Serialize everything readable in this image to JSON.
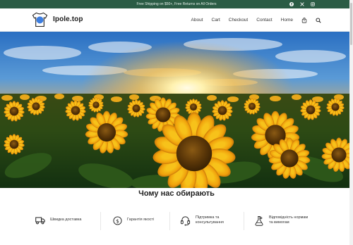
{
  "topbar": {
    "promo": "Free Shipping on $50+, Free Returns on All Orders",
    "socials": [
      "facebook-icon",
      "x-icon",
      "instagram-icon"
    ]
  },
  "header": {
    "brand": "Ipole.top",
    "nav": [
      "About",
      "Cart",
      "Checkout",
      "Contact",
      "Home"
    ],
    "icons": [
      "bag-icon",
      "search-icon"
    ]
  },
  "hero": {
    "image": "sunflower field at sunset"
  },
  "section": {
    "title": "Чому нас обирають"
  },
  "features": [
    {
      "label": "Швидка доставка",
      "icon": "truck-icon"
    },
    {
      "label": "Гарантія якості",
      "icon": "coin-icon"
    },
    {
      "label_line1": "Підтримка та",
      "label_line2": "консультування",
      "icon": "headset-icon"
    },
    {
      "label_line1": "Відповідність нормам",
      "label_line2": "та вимогам",
      "icon": "flask-icon"
    }
  ],
  "colors": {
    "topbar_bg": "#2b5c45",
    "accent_blue": "#3d7ee0"
  }
}
